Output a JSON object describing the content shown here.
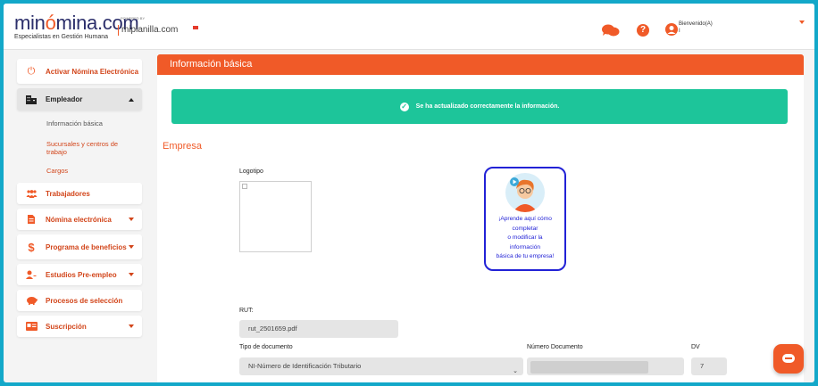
{
  "header": {
    "brand": "minómina.com",
    "tagline": "Especialistas en Gestión Humana",
    "powered": "POWERED BY",
    "partner": "miplanilla.com",
    "welcome_label": "Bienvenido(A)",
    "welcome_user": "I",
    "icons": [
      "chat-icon",
      "help-icon",
      "user-icon",
      "chevron-down-icon"
    ],
    "accent": "#f05a28"
  },
  "sidebar": {
    "items": [
      {
        "label": "Activar Nómina Electrónica",
        "icon": "power-icon"
      },
      {
        "label": "Empleador",
        "icon": "building-icon"
      },
      {
        "label": "Trabajadores",
        "icon": "users-icon"
      },
      {
        "label": "Nómina electrónica",
        "icon": "document-icon"
      },
      {
        "label": "Programa de beneficios",
        "icon": "dollar-icon"
      },
      {
        "label": "Estudios Pre-empleo",
        "icon": "user-add-icon"
      },
      {
        "label": "Procesos de selección",
        "icon": "piggy-bank-icon"
      },
      {
        "label": "Suscripción",
        "icon": "card-icon"
      }
    ],
    "sub_items": [
      "Información básica",
      "Sucursales y centros de trabajo",
      "Cargos"
    ]
  },
  "main": {
    "title": "Información básica",
    "alert": "Se ha actualizado correctamente la información.",
    "section": "Empresa",
    "logo_label": "Logotipo",
    "help_card_lines": [
      "¡Aprende aquí cómo",
      "completar",
      "o modificar la",
      "información",
      "básica de tu empresa!"
    ],
    "rut_label": "RUT:",
    "rut_value": "rut_2501659.pdf",
    "doc_type_label": "Tipo de documento",
    "doc_type_value": "NI-Número de Identificación Tributario",
    "doc_number_label": "Número Documento",
    "dv_label": "DV",
    "dv_value": "7"
  }
}
